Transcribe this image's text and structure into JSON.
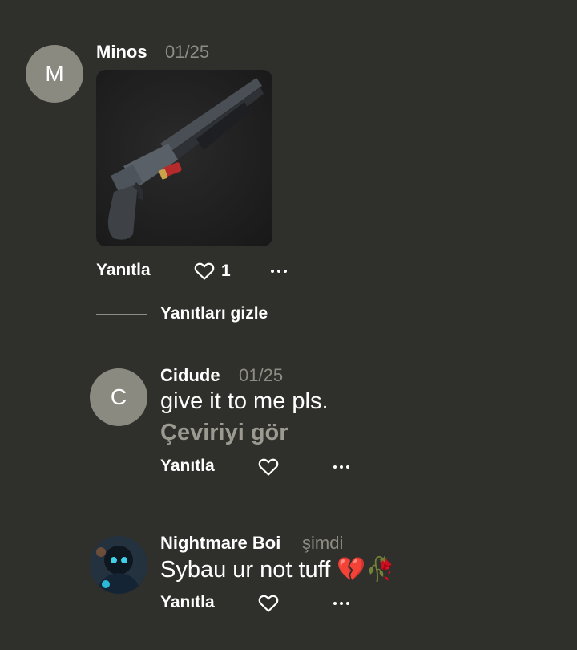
{
  "comments": [
    {
      "avatar_letter": "M",
      "username": "Minos",
      "timestamp": "01/25",
      "reply_label": "Yanıtla",
      "like_count": "1"
    },
    {
      "avatar_letter": "C",
      "username": "Cidude",
      "timestamp": "01/25",
      "text": "give it to me pls.",
      "translate_label": "Çeviriyi gör",
      "reply_label": "Yanıtla"
    },
    {
      "username": "Nightmare Boi",
      "timestamp": "şimdi",
      "text": "Sybau ur not tuff 💔🥀",
      "reply_label": "Yanıtla"
    }
  ],
  "hide_replies_label": "Yanıtları gizle",
  "icons": {
    "like": "heart-outline-icon",
    "more": "more-horizontal-icon"
  },
  "colors": {
    "background": "#2f2f2b",
    "avatar": "#8a8a80",
    "muted_text": "#8d8d84"
  }
}
